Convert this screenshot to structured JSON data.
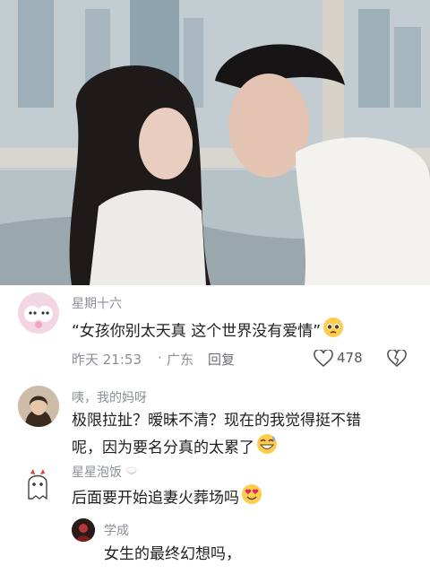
{
  "photo": {
    "description_icon": "movie-still-image"
  },
  "comments": [
    {
      "username": "星期十六",
      "text": "“女孩你别太天真 这个世界没有爱情”",
      "emoji": "pleading-face",
      "time": "昨天 21:53",
      "location": "广东",
      "reply_label": "回复",
      "likes": "478"
    },
    {
      "username": "咦，我的妈呀",
      "text_line1": "极限拉扯？暧昧不清？现在的我觉得挺不错",
      "text_line2": "呢，因为要名分真的太累了",
      "emoji": "grinning-sweat-face"
    },
    {
      "username": "星星泡饭",
      "text": "后面要开始追妻火葬场吗",
      "emoji": "heart-eyes-face"
    },
    {
      "username": "学成",
      "text": "女生的最终幻想吗，"
    }
  ],
  "colors": {
    "meta_gray": "#8a8f99",
    "text_dark": "#1f1f1f"
  }
}
